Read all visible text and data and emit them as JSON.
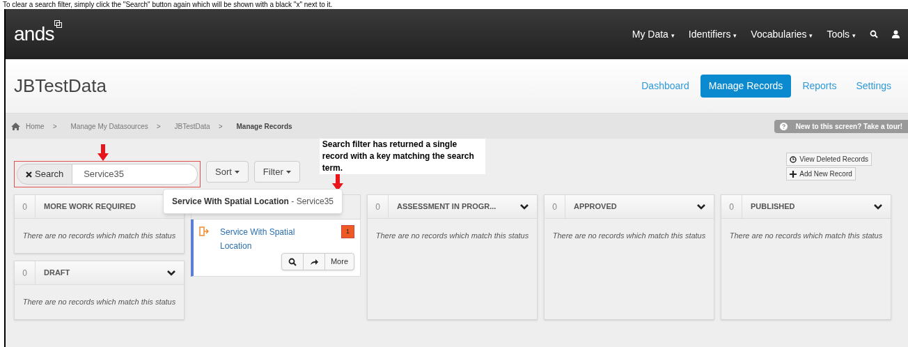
{
  "caption": "To clear a search filter, simply click the \"Search\" button again which will be shown with a black \"x\" next to it.",
  "navbar": {
    "logo": "ands",
    "menus": [
      {
        "label": "My Data",
        "caret": "▾"
      },
      {
        "label": "Identifiers",
        "caret": "▾"
      },
      {
        "label": "Vocabularies",
        "caret": "▾"
      },
      {
        "label": "Tools",
        "caret": "▾"
      }
    ]
  },
  "header": {
    "title": "JBTestData",
    "tabs": [
      {
        "label": "Dashboard",
        "selected": false
      },
      {
        "label": "Manage Records",
        "selected": true
      },
      {
        "label": "Reports",
        "selected": false
      },
      {
        "label": "Settings",
        "selected": false
      }
    ]
  },
  "breadcrumb": {
    "items": [
      "Home",
      "Manage My Datasources",
      "JBTestData",
      "Manage Records"
    ],
    "separator": ">",
    "tour": "New to this screen? Take a tour!"
  },
  "toolbar": {
    "search_button": "Search",
    "search_value": "Service35",
    "sort": "Sort",
    "filter": "Filter",
    "view_deleted": "View Deleted Records",
    "add_new": "Add New Record"
  },
  "annotation": {
    "text": "Search filter has returned a single record with a key matching the search term."
  },
  "columns": [
    {
      "count": "0",
      "title": "MORE WORK REQUIRED",
      "empty": "There are no records which match this status"
    },
    {
      "records": [
        {
          "title": "Service With Spatial Location",
          "badge": "1",
          "more": "More"
        }
      ]
    },
    {
      "count": "0",
      "title": "ASSESSMENT IN PROGR...",
      "empty": "There are no records which match this status"
    },
    {
      "count": "0",
      "title": "APPROVED",
      "empty": "There are no records which match this status"
    },
    {
      "count": "0",
      "title": "PUBLISHED",
      "empty": "There are no records which match this status"
    },
    {
      "count": "0",
      "title": "DRAFT",
      "empty": "There are no records which match this status"
    }
  ],
  "tooltip": {
    "title": "Service With Spatial Location",
    "key": "Service35",
    "separator": "-"
  }
}
